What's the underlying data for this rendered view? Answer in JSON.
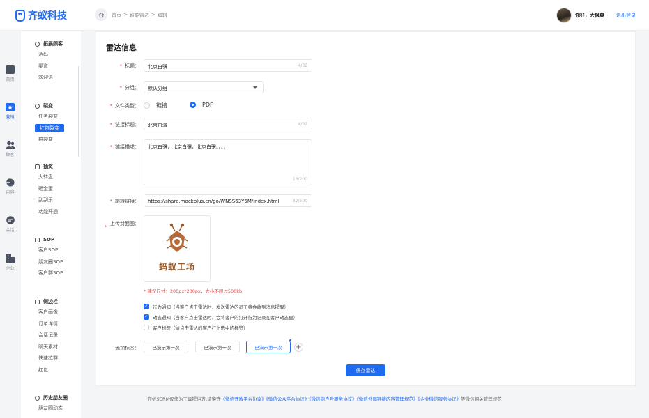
{
  "app": {
    "name": "齐蚁科技",
    "brand_color": "#1f6bf0"
  },
  "header": {
    "breadcrumb": [
      "首页",
      ">",
      "智能雷达",
      ">",
      "编辑"
    ],
    "greeting": "你好，大枫爽",
    "logout": "退出登录"
  },
  "rail": [
    {
      "label": "首页",
      "icon": "home-icon"
    },
    {
      "label": "营销",
      "icon": "star-icon"
    },
    {
      "label": "顾客",
      "icon": "users-icon"
    },
    {
      "label": "内容",
      "icon": "pie-icon"
    },
    {
      "label": "会话",
      "icon": "chat-icon"
    },
    {
      "label": "企业",
      "icon": "building-icon"
    }
  ],
  "submenu": {
    "groups": [
      {
        "title": "拓展顾客",
        "items": [
          "活码",
          "渠道",
          "欢迎语"
        ]
      },
      {
        "title": "裂变",
        "items": [
          "任务裂变",
          "红包裂变",
          "群裂变"
        ],
        "active": "红包裂变"
      },
      {
        "title": "抽奖",
        "items": [
          "大转盘",
          "砸金蛋",
          "刮刮乐",
          "功能开通"
        ]
      },
      {
        "title": "SOP",
        "items": [
          "客户SOP",
          "朋友圈SOP",
          "客户群SOP"
        ]
      },
      {
        "title": "侧边栏",
        "items": [
          "客户画像",
          "订单详情",
          "会话记录",
          "聊天素材",
          "快速拉群",
          "红包"
        ]
      },
      {
        "title": "历史朋友圈",
        "items": [
          "朋友圈动态"
        ]
      }
    ]
  },
  "form": {
    "title": "雷达信息",
    "title_label": "标题：",
    "title_value": "北京白骥",
    "title_count": "4/32",
    "group_label": "分组：",
    "group_value": "默认分组",
    "filetype_label": "文件类型：",
    "filetype_options": [
      "链接",
      "PDF"
    ],
    "filetype_selected": "PDF",
    "link_title_label": "链接标题：",
    "link_title_value": "北京白骥",
    "link_title_count": "4/32",
    "link_desc_label": "链接描述：",
    "link_desc_value": "北京白骥，北京白骥，北京白骥。。。。",
    "link_desc_count": "16/200",
    "jump_label": "跳转链接：",
    "jump_value": "https://share.mockplus.cn/go/WNSS63Y5M/index.html",
    "jump_count": "32/500",
    "cover_label": "上传封面图：",
    "cover_logo_text": "蚂蚁工场",
    "size_hint": "* 建议尺寸：200px*200px，大小不超过500kb",
    "checks": [
      {
        "label": "行为通知（当客户点击雷达时，发送雷达的员工将会收到消息提醒）",
        "checked": true
      },
      {
        "label": "动态通知（当客户点击雷达时，会将客户的打开行为记录在客户动态里）",
        "checked": true
      },
      {
        "label": "客户标签（给点击雷达的客户打上选中的标签）",
        "checked": false
      }
    ],
    "tags_label": "添加标签：",
    "tags": [
      "已演示第一次",
      "已演示第一次",
      "已演示第一次"
    ],
    "add_tag": "+",
    "save": "保存雷达"
  },
  "footer": {
    "prefix": "齐蚁SCRM仅作为工具提供方,请遵守",
    "links": [
      "《微信开放平台协议》",
      "《微信公众平台协议》",
      "《微信商户号服务协议》",
      "《微信外部链接内容管理规范》",
      "《企业微信服务协议》"
    ],
    "suffix": "等微信相关管理规范"
  }
}
